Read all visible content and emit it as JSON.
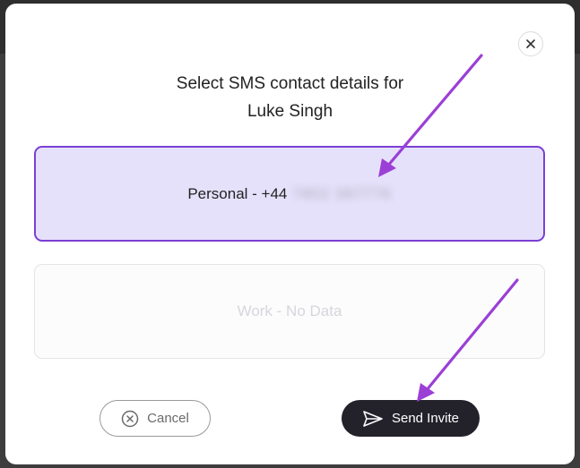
{
  "modal": {
    "title_line1": "Select SMS contact details for",
    "title_line2": "Luke Singh",
    "close_icon": "close-icon"
  },
  "options": {
    "personal": {
      "prefix": "Personal - +44",
      "number_masked": "7802 387776"
    },
    "work": {
      "label": "Work - No Data"
    }
  },
  "actions": {
    "cancel_label": "Cancel",
    "cancel_icon": "x-circle-icon",
    "send_label": "Send Invite",
    "send_icon": "paper-plane-icon"
  },
  "colors": {
    "selected_border": "#7b3fd4",
    "selected_bg": "#e6e1fb",
    "primary_button": "#23222b",
    "annotation_arrow": "#9b3fd6"
  }
}
